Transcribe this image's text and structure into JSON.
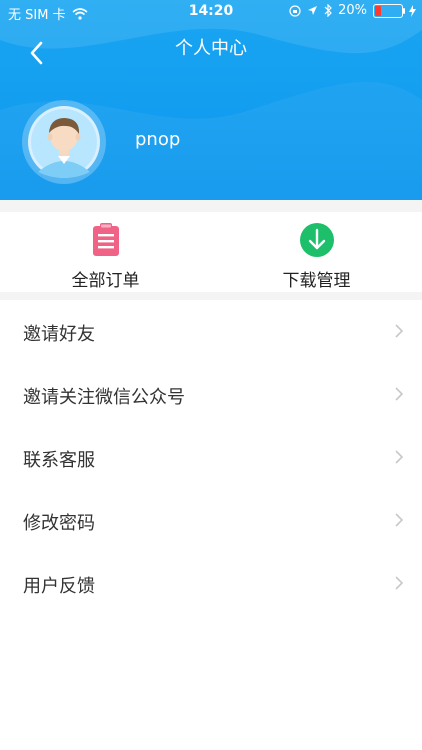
{
  "status_bar": {
    "carrier": "无 SIM 卡",
    "time": "14:20",
    "battery": "20%"
  },
  "header": {
    "title": "个人中心",
    "username": "pnop"
  },
  "shortcuts": [
    {
      "label": "全部订单",
      "icon": "clipboard-icon",
      "color": "#f06386"
    },
    {
      "label": "下载管理",
      "icon": "download-icon",
      "color": "#1ebf6a"
    }
  ],
  "menu": [
    {
      "label": "邀请好友"
    },
    {
      "label": "邀请关注微信公众号"
    },
    {
      "label": "联系客服"
    },
    {
      "label": "修改密码"
    },
    {
      "label": "用户反馈"
    }
  ],
  "colors": {
    "header_blue": "#0f9bf0",
    "battery_low": "#ff3b30"
  }
}
